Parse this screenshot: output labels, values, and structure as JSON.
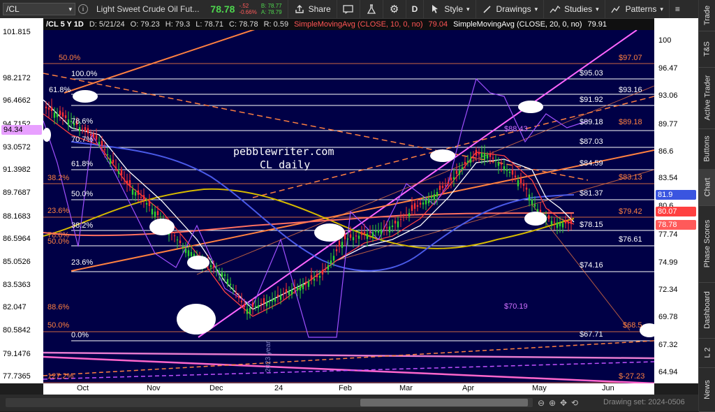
{
  "toolbar": {
    "symbol": "/CL",
    "description": "Light Sweet Crude Oil Fut...",
    "last": "78.78",
    "change": "-.52",
    "change_pct": "-0.66%",
    "bid": "B: 78.77",
    "ask": "A: 78.79",
    "share": "Share",
    "period": "D",
    "style": "Style",
    "drawings": "Drawings",
    "studies": "Studies",
    "patterns": "Patterns"
  },
  "info": {
    "symbol_period": "/CL 5 Y 1D",
    "date": "D: 5/21/24",
    "open": "O: 79.23",
    "high": "H: 79.3",
    "low": "L: 78.71",
    "close": "C: 78.78",
    "range": "R: 0.59",
    "sma10": "SimpleMovingAvg (CLOSE, 10, 0, no)",
    "sma10_val": "79.04",
    "sma20": "SimpleMovingAvg (CLOSE, 20, 0, no)",
    "sma20_val": "79.91"
  },
  "left_axis": [
    "101.815",
    "98.2172",
    "96.4662",
    "94.7152",
    "93.0572",
    "91.3982",
    "89.7687",
    "88.1683",
    "86.5964",
    "85.0526",
    "83.5363",
    "82.047",
    "80.5842",
    "79.1476",
    "77.7365"
  ],
  "left_tag": "94.34",
  "right_axis": [
    "100",
    "96.47",
    "93.06",
    "89.77",
    "86.6",
    "83.54",
    "80.6",
    "77.74",
    "74.99",
    "72.34",
    "69.78",
    "67.32",
    "64.94"
  ],
  "right_tags": {
    "sma20": "81.9",
    "sma10": "80.07",
    "last": "78.78"
  },
  "bottom_axis": [
    "Oct",
    "Nov",
    "Dec",
    "24",
    "Feb",
    "Mar",
    "Apr",
    "May",
    "Jun"
  ],
  "fib_left": [
    "100.0%",
    "61.8%",
    "78.6%",
    "70.7%",
    "61.8%",
    "50.0%",
    "38.2%",
    "23.6%",
    "0.0%"
  ],
  "fib_left_orange": [
    "50.0%",
    "38.2%",
    "23.6%",
    "78.6%",
    "50.0%",
    "88.6%",
    "50.0%",
    "127.2%"
  ],
  "fib_prices_white": [
    "$95.03",
    "$93.16",
    "$91.92",
    "$89.18",
    "$87.03",
    "$84.59",
    "$81.37",
    "$78.15",
    "$76.61",
    "$74.16",
    "$67.71"
  ],
  "fib_prices_orange": [
    "$97.07",
    "$89.18",
    "$83.13",
    "$79.42",
    "$68.5",
    "$-27.23"
  ],
  "fib_prices_purple": [
    "$88.43",
    "$70.19"
  ],
  "watermark_line1": "pebblewriter.com",
  "watermark_line2": "CL daily",
  "year_label": "2023 year",
  "status": {
    "drawing_set": "Drawing set: 2024-0506"
  },
  "side_tabs": [
    "Trade",
    "T&S",
    "Active Trader",
    "Buttons",
    "Chart",
    "Phase Scores",
    "Dashboard",
    "L 2",
    "News"
  ],
  "colors": {
    "background": "#000046",
    "sma200": "#d4b800",
    "sma50": "#4a5ae8",
    "sma10": "#ff4040",
    "sma20": "#ffffff",
    "fib_white": "#ffffff",
    "fib_orange": "#ff8040",
    "channel": "#ff66ff",
    "price": "#d0d0ff"
  }
}
